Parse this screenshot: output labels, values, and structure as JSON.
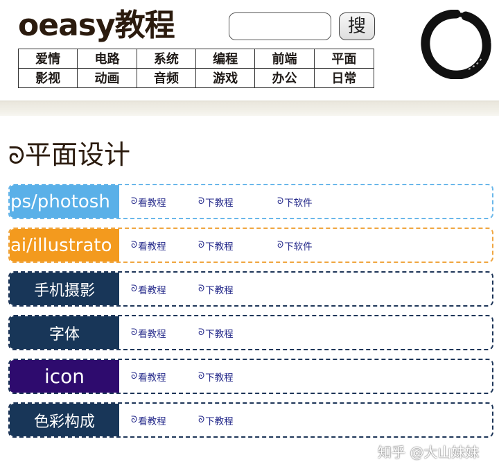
{
  "header": {
    "logo_text": "oeasy教程",
    "search": {
      "value": "",
      "placeholder": ""
    },
    "search_button_label": "搜",
    "nav": [
      {
        "label": "爱情"
      },
      {
        "label": "电路"
      },
      {
        "label": "系统"
      },
      {
        "label": "编程"
      },
      {
        "label": "前端"
      },
      {
        "label": "平面"
      },
      {
        "label": "影视"
      },
      {
        "label": "动画"
      },
      {
        "label": "音频"
      },
      {
        "label": "游戏"
      },
      {
        "label": "办公"
      },
      {
        "label": "日常"
      }
    ],
    "logo_icon": "enso-circle-icon"
  },
  "main": {
    "spiral_glyph": "ᘐ",
    "page_title": "平面设计",
    "rows": [
      {
        "label": "ps/photosh",
        "label_color": "#5ab0e8",
        "border_color": "#6ab7ea",
        "links": [
          "看教程",
          "下教程",
          "下软件"
        ]
      },
      {
        "label": "ai/illustrato",
        "label_color": "#f39a1e",
        "border_color": "#f0a640",
        "links": [
          "看教程",
          "下教程",
          "下软件"
        ]
      },
      {
        "label": "手机摄影",
        "label_color": "#183658",
        "border_color": "#1d3558",
        "links": [
          "看教程",
          "下教程"
        ]
      },
      {
        "label": "字体",
        "label_color": "#183658",
        "border_color": "#1d3558",
        "links": [
          "看教程",
          "下教程"
        ]
      },
      {
        "label": "icon",
        "label_color": "#2e0b6e",
        "border_color": "#1d3558",
        "links": [
          "看教程",
          "下教程"
        ]
      },
      {
        "label": "色彩构成",
        "label_color": "#183658",
        "border_color": "#1d3558",
        "links": [
          "看教程",
          "下教程"
        ]
      }
    ]
  },
  "watermark": "知乎 @大山妹妹",
  "colors": {
    "logo_text": "#2b1b0e",
    "link_text": "#24298a",
    "header_bar": "#efece3"
  }
}
